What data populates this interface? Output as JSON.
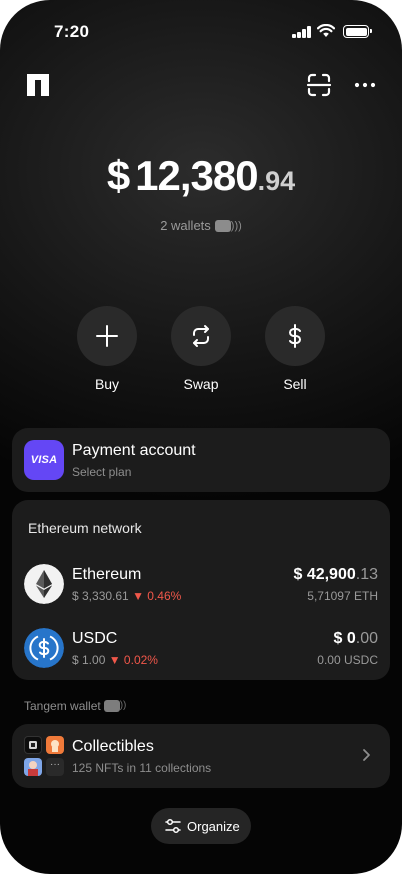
{
  "status_bar": {
    "time": "7:20"
  },
  "balance": {
    "currency_symbol": "$",
    "main": "12,380",
    "cents": ".94",
    "wallets_label": "2 wallets"
  },
  "actions": [
    {
      "label": "Buy",
      "icon": "plus-icon"
    },
    {
      "label": "Swap",
      "icon": "swap-icon"
    },
    {
      "label": "Sell",
      "icon": "dollar-icon"
    }
  ],
  "payment": {
    "brand": "VISA",
    "title": "Payment account",
    "subtitle": "Select plan"
  },
  "network": {
    "title": "Ethereum network",
    "tokens": [
      {
        "name": "Ethereum",
        "price": "$ 3,330.61",
        "change": "▼ 0.46%",
        "value_main": "$ 42,900",
        "value_dec": ".13",
        "amount": "5,71097 ETH",
        "icon": "ethereum-icon"
      },
      {
        "name": "USDC",
        "price": "$ 1.00",
        "change": "▼ 0.02%",
        "value_main": "$ 0",
        "value_dec": ".00",
        "amount": "0.00 USDC",
        "icon": "usdc-icon"
      }
    ]
  },
  "tangem_wallet_label": "Tangem wallet",
  "collectibles": {
    "title": "Collectibles",
    "subtitle": "125 NFTs in 11 collections"
  },
  "organize_label": "Organize",
  "colors": {
    "accent_visa": "#6447f5",
    "negative": "#f0574a",
    "card_bg": "#1c1c1c"
  }
}
